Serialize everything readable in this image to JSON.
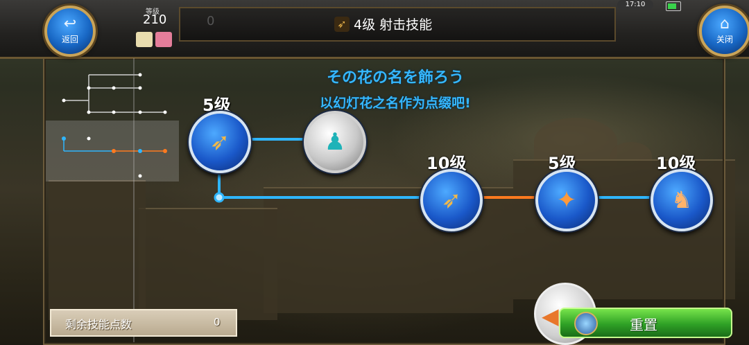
{
  "topbar": {
    "back_label": "返回",
    "close_label": "关闭",
    "level_caption": "等级",
    "level_value": "210",
    "title_counter": "0",
    "title": "4级 射击技能",
    "clock": "17:10"
  },
  "headings": {
    "line1": "その花の名を飾ろう",
    "line2": "以幻灯花之名作为点缀吧!"
  },
  "skills": [
    {
      "level_label": "5级",
      "icon": "bow-arrow-icon",
      "locked": false
    },
    {
      "level_label": "",
      "icon": "silhouette-icon",
      "locked": true
    },
    {
      "level_label": "10级",
      "icon": "bow-icon",
      "locked": false
    },
    {
      "level_label": "5级",
      "icon": "spiral-arrow-icon",
      "locked": false
    },
    {
      "level_label": "10级",
      "icon": "figures-icon",
      "locked": false
    }
  ],
  "footer": {
    "points_label": "剩余技能点数",
    "points_value": "0",
    "reset_label": "重置"
  },
  "colors": {
    "link_active": "#2fb6ff",
    "link_orange": "#ff7a1f",
    "heading": "#35b7ff"
  }
}
